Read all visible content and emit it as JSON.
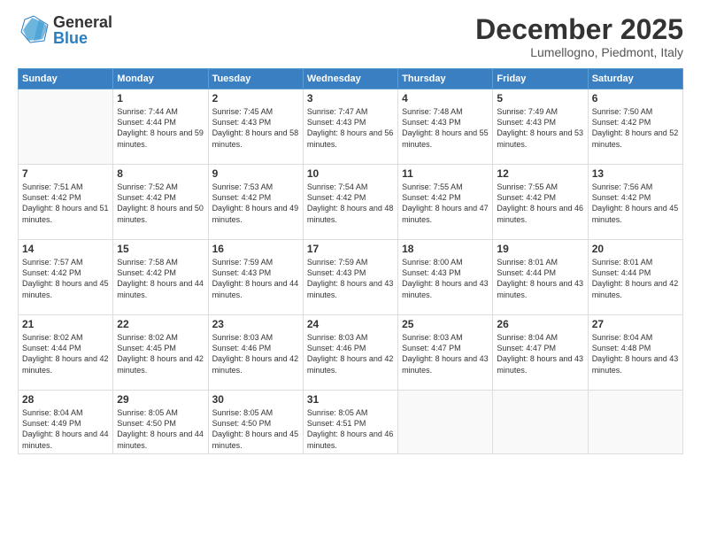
{
  "header": {
    "logo": {
      "general": "General",
      "blue": "Blue"
    },
    "title": "December 2025",
    "location": "Lumellogno, Piedmont, Italy"
  },
  "days_of_week": [
    "Sunday",
    "Monday",
    "Tuesday",
    "Wednesday",
    "Thursday",
    "Friday",
    "Saturday"
  ],
  "weeks": [
    [
      {
        "day": "",
        "content": ""
      },
      {
        "day": "1",
        "sunrise": "7:44 AM",
        "sunset": "4:44 PM",
        "daylight": "8 hours and 59 minutes."
      },
      {
        "day": "2",
        "sunrise": "7:45 AM",
        "sunset": "4:43 PM",
        "daylight": "8 hours and 58 minutes."
      },
      {
        "day": "3",
        "sunrise": "7:47 AM",
        "sunset": "4:43 PM",
        "daylight": "8 hours and 56 minutes."
      },
      {
        "day": "4",
        "sunrise": "7:48 AM",
        "sunset": "4:43 PM",
        "daylight": "8 hours and 55 minutes."
      },
      {
        "day": "5",
        "sunrise": "7:49 AM",
        "sunset": "4:43 PM",
        "daylight": "8 hours and 53 minutes."
      },
      {
        "day": "6",
        "sunrise": "7:50 AM",
        "sunset": "4:42 PM",
        "daylight": "8 hours and 52 minutes."
      }
    ],
    [
      {
        "day": "7",
        "sunrise": "7:51 AM",
        "sunset": "4:42 PM",
        "daylight": "8 hours and 51 minutes."
      },
      {
        "day": "8",
        "sunrise": "7:52 AM",
        "sunset": "4:42 PM",
        "daylight": "8 hours and 50 minutes."
      },
      {
        "day": "9",
        "sunrise": "7:53 AM",
        "sunset": "4:42 PM",
        "daylight": "8 hours and 49 minutes."
      },
      {
        "day": "10",
        "sunrise": "7:54 AM",
        "sunset": "4:42 PM",
        "daylight": "8 hours and 48 minutes."
      },
      {
        "day": "11",
        "sunrise": "7:55 AM",
        "sunset": "4:42 PM",
        "daylight": "8 hours and 47 minutes."
      },
      {
        "day": "12",
        "sunrise": "7:55 AM",
        "sunset": "4:42 PM",
        "daylight": "8 hours and 46 minutes."
      },
      {
        "day": "13",
        "sunrise": "7:56 AM",
        "sunset": "4:42 PM",
        "daylight": "8 hours and 45 minutes."
      }
    ],
    [
      {
        "day": "14",
        "sunrise": "7:57 AM",
        "sunset": "4:42 PM",
        "daylight": "8 hours and 45 minutes."
      },
      {
        "day": "15",
        "sunrise": "7:58 AM",
        "sunset": "4:42 PM",
        "daylight": "8 hours and 44 minutes."
      },
      {
        "day": "16",
        "sunrise": "7:59 AM",
        "sunset": "4:43 PM",
        "daylight": "8 hours and 44 minutes."
      },
      {
        "day": "17",
        "sunrise": "7:59 AM",
        "sunset": "4:43 PM",
        "daylight": "8 hours and 43 minutes."
      },
      {
        "day": "18",
        "sunrise": "8:00 AM",
        "sunset": "4:43 PM",
        "daylight": "8 hours and 43 minutes."
      },
      {
        "day": "19",
        "sunrise": "8:01 AM",
        "sunset": "4:44 PM",
        "daylight": "8 hours and 43 minutes."
      },
      {
        "day": "20",
        "sunrise": "8:01 AM",
        "sunset": "4:44 PM",
        "daylight": "8 hours and 42 minutes."
      }
    ],
    [
      {
        "day": "21",
        "sunrise": "8:02 AM",
        "sunset": "4:44 PM",
        "daylight": "8 hours and 42 minutes."
      },
      {
        "day": "22",
        "sunrise": "8:02 AM",
        "sunset": "4:45 PM",
        "daylight": "8 hours and 42 minutes."
      },
      {
        "day": "23",
        "sunrise": "8:03 AM",
        "sunset": "4:46 PM",
        "daylight": "8 hours and 42 minutes."
      },
      {
        "day": "24",
        "sunrise": "8:03 AM",
        "sunset": "4:46 PM",
        "daylight": "8 hours and 42 minutes."
      },
      {
        "day": "25",
        "sunrise": "8:03 AM",
        "sunset": "4:47 PM",
        "daylight": "8 hours and 43 minutes."
      },
      {
        "day": "26",
        "sunrise": "8:04 AM",
        "sunset": "4:47 PM",
        "daylight": "8 hours and 43 minutes."
      },
      {
        "day": "27",
        "sunrise": "8:04 AM",
        "sunset": "4:48 PM",
        "daylight": "8 hours and 43 minutes."
      }
    ],
    [
      {
        "day": "28",
        "sunrise": "8:04 AM",
        "sunset": "4:49 PM",
        "daylight": "8 hours and 44 minutes."
      },
      {
        "day": "29",
        "sunrise": "8:05 AM",
        "sunset": "4:50 PM",
        "daylight": "8 hours and 44 minutes."
      },
      {
        "day": "30",
        "sunrise": "8:05 AM",
        "sunset": "4:50 PM",
        "daylight": "8 hours and 45 minutes."
      },
      {
        "day": "31",
        "sunrise": "8:05 AM",
        "sunset": "4:51 PM",
        "daylight": "8 hours and 46 minutes."
      },
      {
        "day": "",
        "content": ""
      },
      {
        "day": "",
        "content": ""
      },
      {
        "day": "",
        "content": ""
      }
    ]
  ]
}
